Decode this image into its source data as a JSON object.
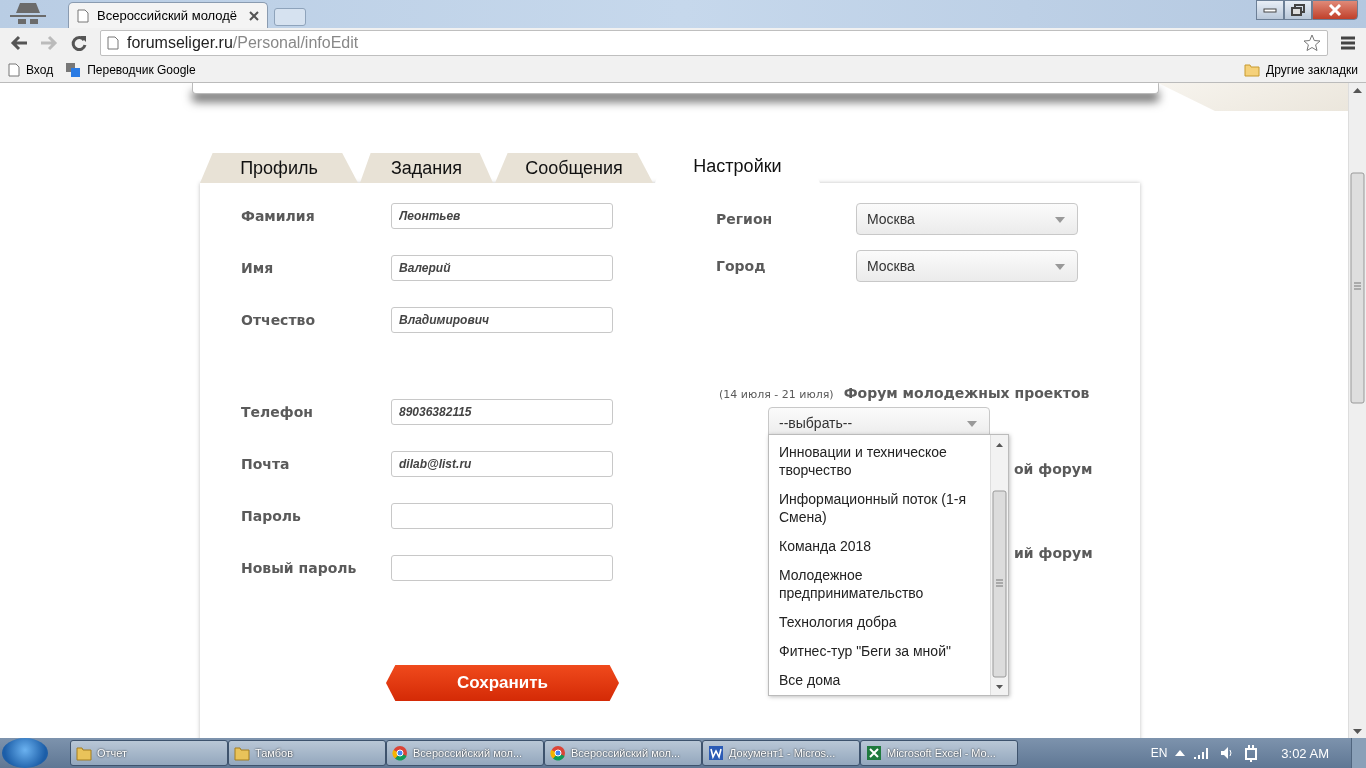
{
  "browser": {
    "tab_title": "Всероссийский молодё",
    "url_host": "forumseliger.ru",
    "url_path": "/Personal/infoEdit",
    "bookmarks": [
      "Вход",
      "Переводчик Google"
    ],
    "other_bookmarks": "Другие закладки"
  },
  "tabs": [
    {
      "label": "Профиль",
      "selected": false
    },
    {
      "label": "Задания",
      "selected": false
    },
    {
      "label": "Сообщения",
      "selected": false
    },
    {
      "label": "Настройки",
      "selected": true
    }
  ],
  "personal_fields": [
    {
      "label": "Фамилия",
      "value": "Леонтьев"
    },
    {
      "label": "Имя",
      "value": "Валерий"
    },
    {
      "label": "Отчество",
      "value": "Владимирович"
    }
  ],
  "contact_fields": [
    {
      "label": "Телефон",
      "value": "89036382115"
    },
    {
      "label": "Почта",
      "value": "dilab@list.ru"
    },
    {
      "label": "Пароль"
    },
    {
      "label": "Новый пароль"
    }
  ],
  "location_selects": [
    {
      "label": "Регион",
      "value": "Москва"
    },
    {
      "label": "Город",
      "value": "Москва"
    }
  ],
  "forum": {
    "dates": "(14 июля - 21 июля)",
    "title": "Форум молодежных проектов",
    "select_value": "--выбрать--",
    "options": [
      "Инновации и техническое творчество",
      "Информационный поток (1-я Смена)",
      "Команда 2018",
      "Молодежное предпринимательство",
      "Технология добра",
      "Фитнес-тур \"Беги за мной\"",
      "Все дома"
    ],
    "hidden_titles": [
      "ой форум",
      "ий форум"
    ]
  },
  "save_button": "Сохранить",
  "taskbar": {
    "items": [
      {
        "kind": "folder",
        "label": "Отчет"
      },
      {
        "kind": "folder",
        "label": "Тамбов"
      },
      {
        "kind": "chrome",
        "label": "Всероссийский мол..."
      },
      {
        "kind": "chrome",
        "label": "Всероссийский мол..."
      },
      {
        "kind": "word",
        "label": "Документ1 - Micros..."
      },
      {
        "kind": "excel",
        "label": "Microsoft Excel - Mo..."
      }
    ],
    "language": "EN",
    "time": "3:02 AM"
  }
}
